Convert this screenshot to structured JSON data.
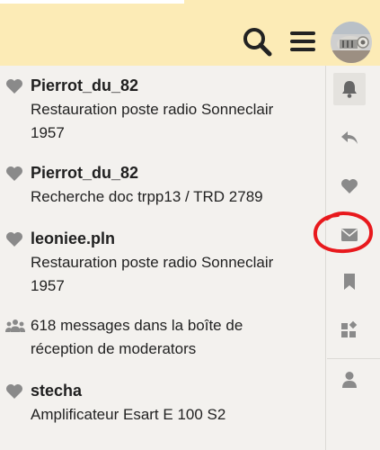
{
  "header": {
    "search_icon": "search-icon",
    "menu_icon": "hamburger-menu-icon",
    "avatar": "user-avatar",
    "background_color": "#fcebb6"
  },
  "notifications": [
    {
      "icon": "heart-icon",
      "user": "Pierrot_du_82",
      "text_line1": "Restauration poste radio Sonneclair",
      "text_line2": "1957"
    },
    {
      "icon": "heart-icon",
      "user": "Pierrot_du_82",
      "text_line1": "Recherche doc trpp13 / TRD 2789",
      "text_line2": ""
    },
    {
      "icon": "heart-icon",
      "user": "leoniee.pln",
      "text_line1": "Restauration poste radio Sonneclair",
      "text_line2": "1957"
    },
    {
      "icon": "users-icon",
      "user": "",
      "text_line1": "618 messages dans la boîte de",
      "text_line2": "réception de moderators"
    },
    {
      "icon": "heart-icon",
      "user": "stecha",
      "text_line1": "Amplificateur Esart E 100 S2",
      "text_line2": ""
    }
  ],
  "rail": {
    "items": [
      {
        "icon": "bell-icon",
        "active": true
      },
      {
        "icon": "reply-icon",
        "active": false
      },
      {
        "icon": "heart-icon",
        "active": false
      },
      {
        "icon": "envelope-icon",
        "active": false,
        "highlighted": true
      },
      {
        "icon": "bookmark-icon",
        "active": false
      },
      {
        "icon": "widgets-icon",
        "active": false
      },
      {
        "icon": "user-icon",
        "active": false
      }
    ],
    "highlight_color": "#e8191d"
  }
}
